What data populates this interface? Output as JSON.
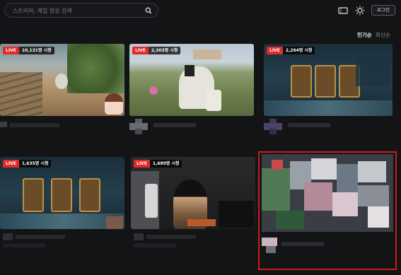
{
  "search": {
    "placeholder": "스트리머, 게임 영상 검색",
    "value": ""
  },
  "header": {
    "login_label": "로그인"
  },
  "sort": {
    "active": "인기순",
    "inactive": "최신순"
  },
  "cards": [
    {
      "badge": "LIVE",
      "viewers": "10,131명 시청"
    },
    {
      "badge": "LIVE",
      "viewers": "2,303명 시청"
    },
    {
      "badge": "LIVE",
      "viewers": "2,264명 시청"
    },
    {
      "badge": "LIVE",
      "viewers": "1,635명 시청"
    },
    {
      "badge": "LIVE",
      "viewers": "1,689명 시청"
    }
  ],
  "icons": {
    "search": "search-icon",
    "ticket": "ticket-icon",
    "theme": "sun-icon"
  },
  "colors": {
    "live": "#e02b2b",
    "highlight": "#d01b1b",
    "background": "#131416"
  }
}
